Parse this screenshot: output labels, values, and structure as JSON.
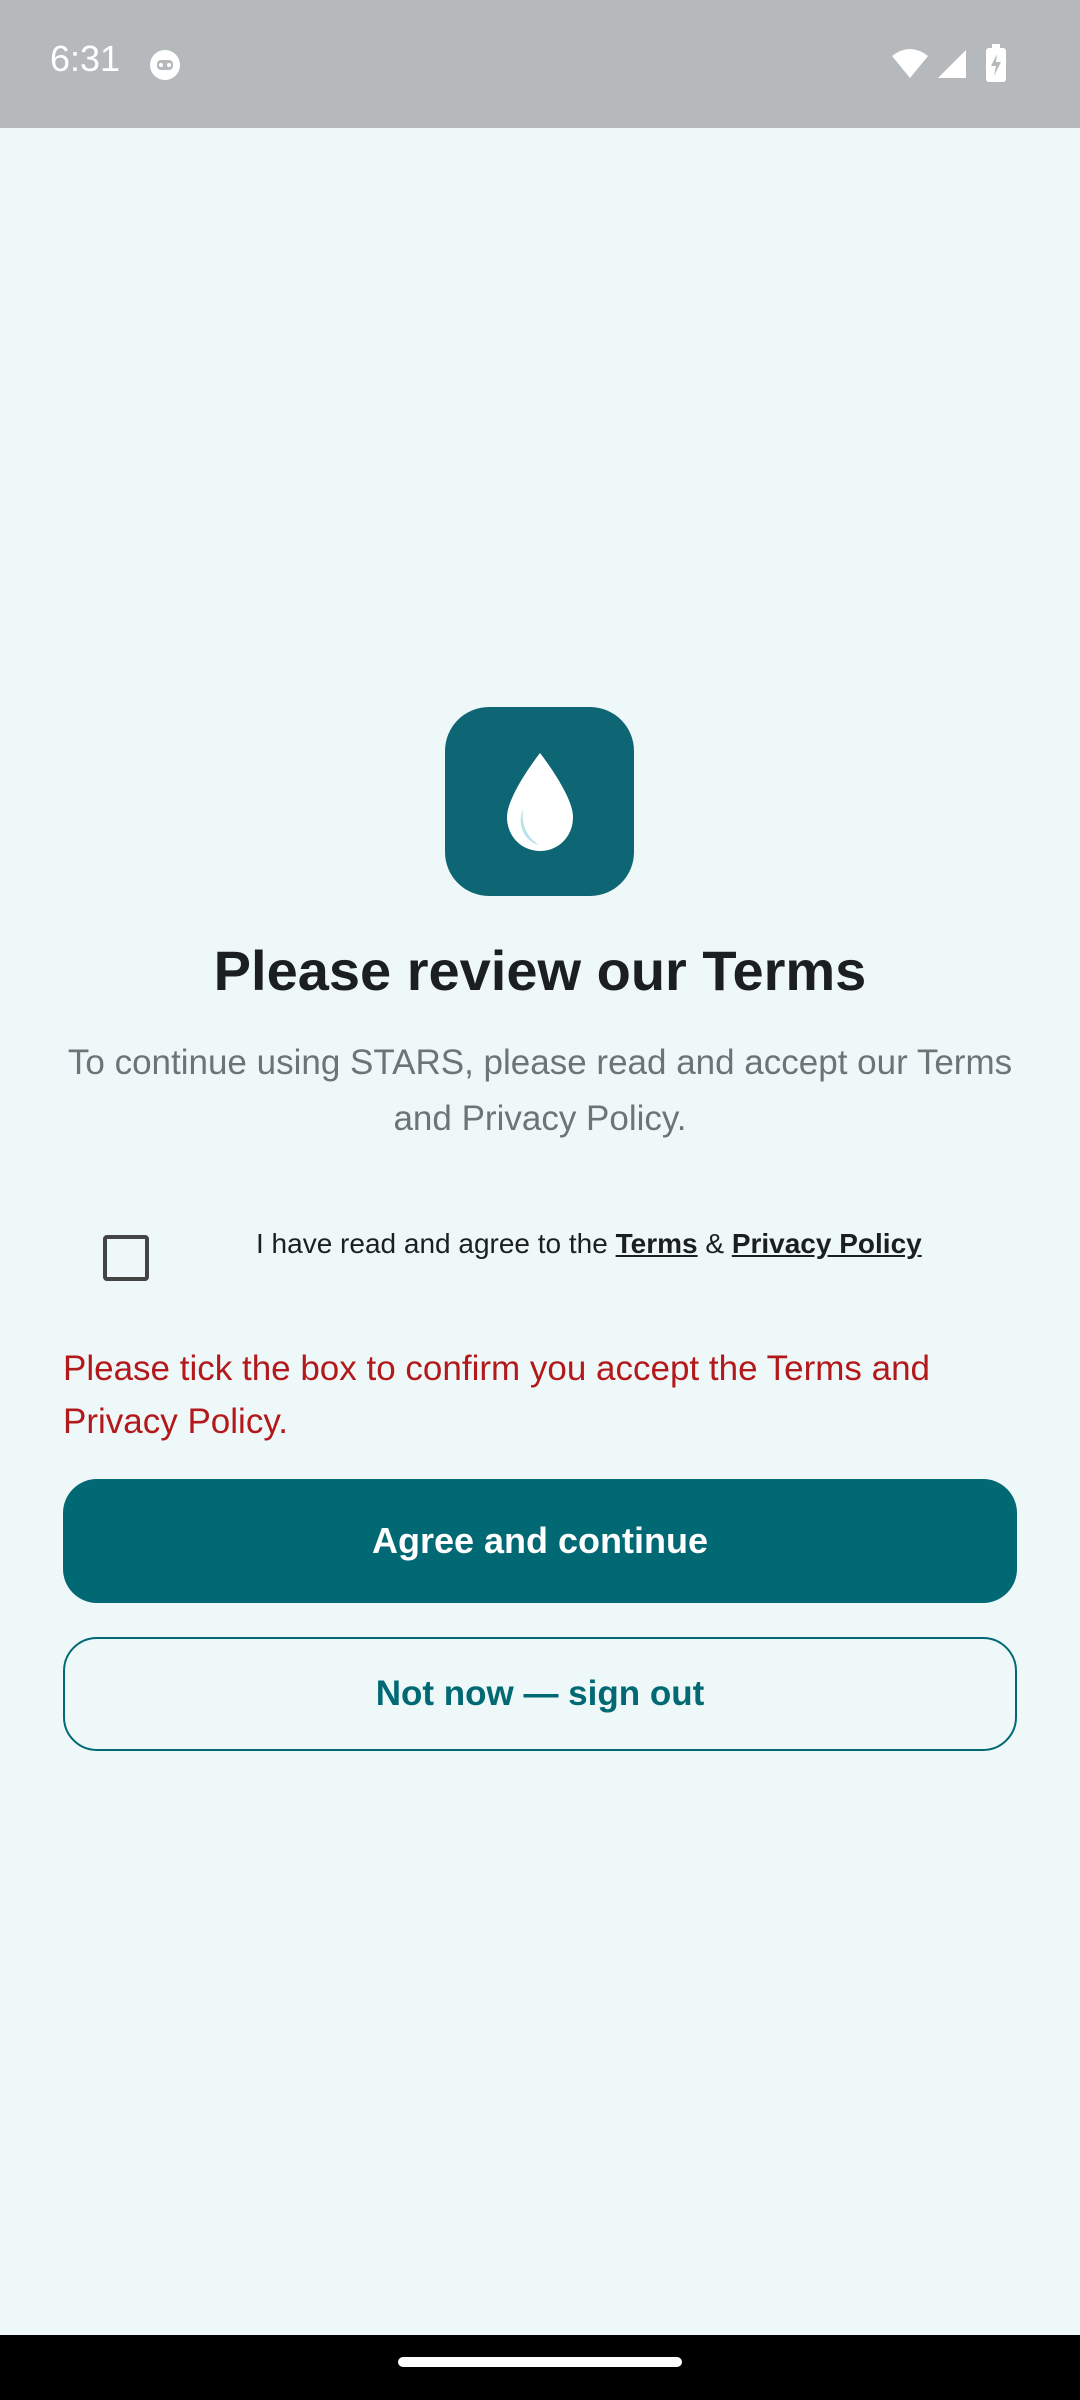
{
  "status_bar": {
    "time": "6:31",
    "icons": [
      "app-notification-icon",
      "wifi-icon",
      "cell-signal-icon",
      "battery-charging-icon"
    ]
  },
  "logo": {
    "icon": "water-drop-icon",
    "tile_color": "#0e6674"
  },
  "screen": {
    "title": "Please review our Terms",
    "subtitle": "To continue using STARS, please read and accept our Terms and Privacy Policy."
  },
  "consent": {
    "checked": false,
    "prefix": "I have read and agree to the ",
    "terms_link": "Terms",
    "separator": " & ",
    "privacy_link": "Privacy Policy"
  },
  "error": {
    "message": "Please tick the box to confirm you accept the Terms and Privacy Policy.",
    "color": "#b3191b"
  },
  "actions": {
    "primary_label": "Agree and continue",
    "secondary_label": "Not now — sign out",
    "accent": "#016974"
  }
}
